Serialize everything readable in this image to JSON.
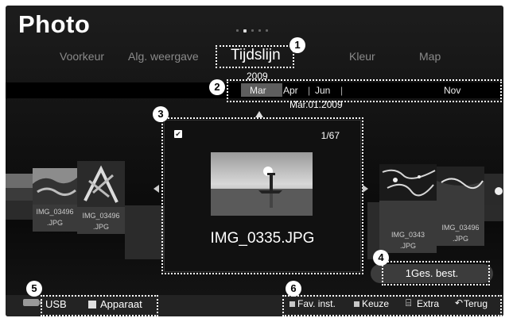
{
  "app": {
    "title": "Photo"
  },
  "tabs": [
    {
      "label": "Voorkeur"
    },
    {
      "label": "Alg. weergave"
    },
    {
      "label": "Tijdslijn"
    },
    {
      "label": "Kleur"
    },
    {
      "label": "Map"
    }
  ],
  "selected_tab_index": 2,
  "timeline": {
    "year": "2009",
    "months": [
      {
        "label": "Mar"
      },
      {
        "label": "Apr"
      },
      {
        "label": "Jun"
      },
      {
        "label": "Nov"
      }
    ],
    "selected_month": "Mar",
    "selected_date": "Mar.01.2009"
  },
  "current_photo": {
    "counter": "1/67",
    "checked": true,
    "filename": "IMG_0335.JPG"
  },
  "left_thumbs": [
    {
      "label_line1": "IMG_03496",
      "label_line2": ".JPG"
    },
    {
      "label_line1": "IMG_03496",
      "label_line2": ".JPG"
    }
  ],
  "right_thumbs": [
    {
      "label_line1": "IMG_0343",
      "label_line2": ".JPG"
    },
    {
      "label_line1": "IMG_03496",
      "label_line2": ".JPG"
    }
  ],
  "select_button": {
    "label": "1Ges. best."
  },
  "source": {
    "usb_label": "USB",
    "device_label": "Apparaat"
  },
  "footer_keys": [
    {
      "label": "Fav. inst.",
      "color": "#c8c8c8"
    },
    {
      "label": "Keuze",
      "color": "#c8c8c8"
    },
    {
      "label": "Extra",
      "icon": "tools-icon"
    },
    {
      "label": "Terug",
      "icon": "return-icon"
    }
  ],
  "callouts": [
    "1",
    "2",
    "3",
    "4",
    "5",
    "6"
  ]
}
